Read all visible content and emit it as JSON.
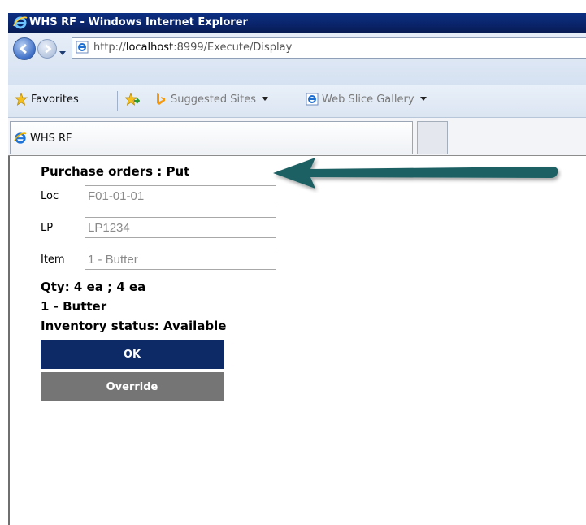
{
  "window": {
    "title": "WHS RF - Windows Internet Explorer"
  },
  "address_bar": {
    "url_prefix": "http://",
    "url_host": "localhost",
    "url_rest": ":8999/Execute/Display"
  },
  "favorites_bar": {
    "favorites_label": "Favorites",
    "suggested_sites_label": "Suggested Sites",
    "web_slice_gallery_label": "Web Slice Gallery"
  },
  "tabs": [
    {
      "label": "WHS RF"
    }
  ],
  "page": {
    "title": "Purchase orders : Put",
    "fields": [
      {
        "label": "Loc",
        "value": "F01-01-01"
      },
      {
        "label": "LP",
        "value": "LP1234"
      },
      {
        "label": "Item",
        "value": "1 - Butter"
      }
    ],
    "qty_line": "Qty: 4 ea ; 4 ea",
    "item_line": "1 - Butter",
    "status_line": "Inventory status: Available",
    "ok_label": "OK",
    "override_label": "Override"
  },
  "colors": {
    "ok_button": "#0d2a66",
    "override_button": "#757575",
    "annotation_arrow": "#1f6164",
    "titlebar": "#0a246a"
  }
}
